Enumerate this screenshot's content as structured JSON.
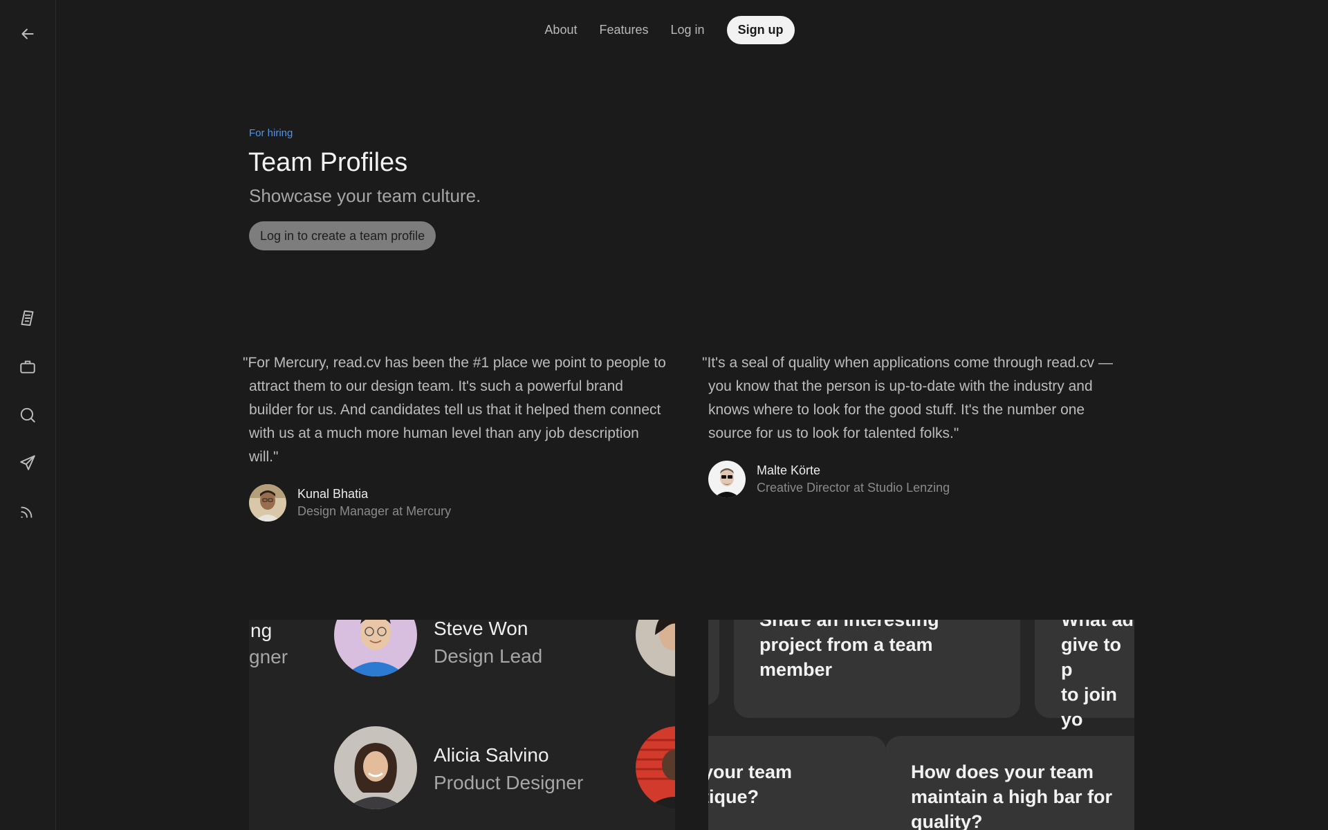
{
  "sidebar": {
    "icons": [
      "back-arrow-icon",
      "document-icon",
      "briefcase-icon",
      "search-icon",
      "send-icon",
      "rss-icon"
    ]
  },
  "nav": {
    "about": "About",
    "features": "Features",
    "login": "Log in",
    "signup": "Sign up"
  },
  "hero": {
    "eyebrow": "For hiring",
    "title": "Team Profiles",
    "subtitle": "Showcase your team culture.",
    "cta": "Log in to create a team profile",
    "eyebrow_color": "#4f94e8"
  },
  "quotes": [
    {
      "text": "\"For Mercury, read.cv has been the #1 place we point to people to attract them to our design team. It's such a powerful brand builder for us. And candidates tell us that it helped them connect with us at a much more human level than any job description will.\"",
      "name": "Kunal Bhatia",
      "role": "Design Manager at Mercury"
    },
    {
      "text": "\"It's a seal of quality when applications come through read.cv — you know that the person is up-to-date with the industry and knows where to look for the good stuff. It's the number one source for us to look for talented folks.\"",
      "name": "Malte Körte",
      "role": "Creative Director at Studio Lenzing"
    }
  ],
  "members": {
    "partial_left_name": "ng",
    "partial_left_role": "gner",
    "steve_name": "Steve Won",
    "steve_role": "Design Lead",
    "alicia_name": "Alicia Salvino",
    "alicia_role": "Product Designer"
  },
  "questions": {
    "card1": "Share an interesting\nproject from a team\nmember",
    "card2": "What ad\ngive to p\nto join yo",
    "card3": "your team\ntique?",
    "card4": "How does your team\nmaintain a high bar for\nquality?"
  }
}
